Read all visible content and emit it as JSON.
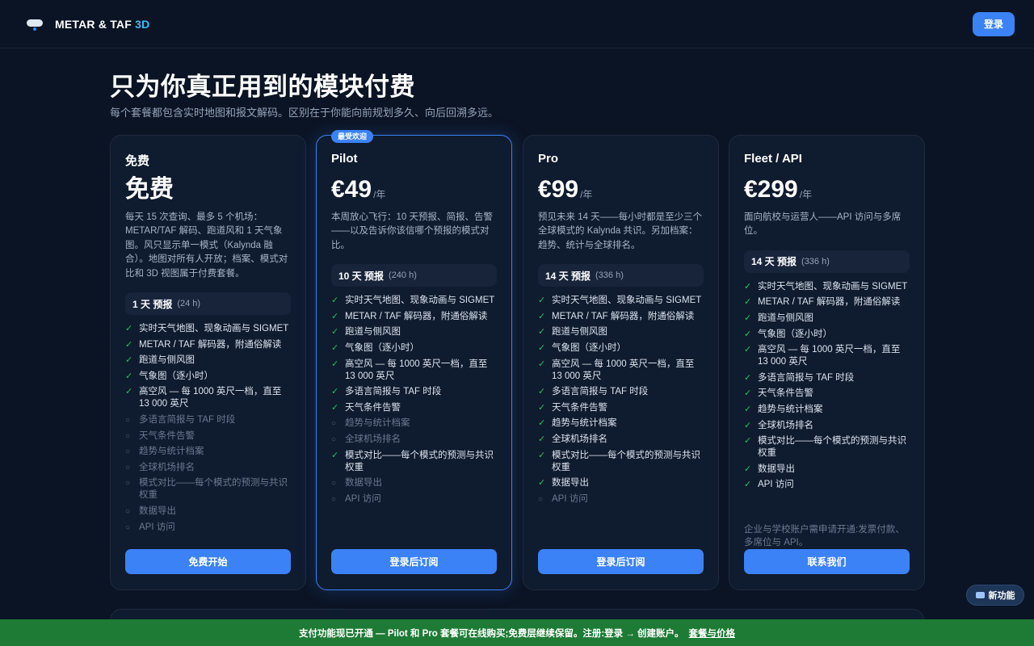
{
  "header": {
    "brand_main": "METAR & TAF",
    "brand_accent": "3D",
    "login_label": "登录"
  },
  "hero": {
    "title": "只为你真正用到的模块付费",
    "subtitle": "每个套餐都包含实时地图和报文解码。区别在于你能向前规划多久、向后回溯多远。"
  },
  "plans": [
    {
      "name": "免费",
      "price": "免费",
      "period": "",
      "badge": "",
      "description": "每天 15 次查询、最多 5 个机场：METAR/TAF 解码、跑道风和 1 天气象图。风只显示单一模式（Kalynda 融合）。地图对所有人开放；档案、模式对比和 3D 视图属于付费套餐。",
      "forecast_label": "1 天 预报",
      "forecast_hours": "(24 h)",
      "features": [
        {
          "label": "实时天气地图、现象动画与 SIGMET",
          "included": true
        },
        {
          "label": "METAR / TAF 解码器，附通俗解读",
          "included": true
        },
        {
          "label": "跑道与侧风图",
          "included": true
        },
        {
          "label": "气象图（逐小时）",
          "included": true
        },
        {
          "label": "高空风 — 每 1000 英尺一档，直至 13 000 英尺",
          "included": true
        },
        {
          "label": "多语言简报与 TAF 时段",
          "included": false
        },
        {
          "label": "天气条件告警",
          "included": false
        },
        {
          "label": "趋势与统计档案",
          "included": false
        },
        {
          "label": "全球机场排名",
          "included": false
        },
        {
          "label": "模式对比——每个模式的预测与共识权重",
          "included": false
        },
        {
          "label": "数据导出",
          "included": false
        },
        {
          "label": "API 访问",
          "included": false
        }
      ],
      "note": "",
      "cta_label": "免费开始"
    },
    {
      "name": "Pilot",
      "price": "€49",
      "period": "/年",
      "badge": "最受欢迎",
      "description": "本周放心飞行：10 天预报、简报、告警——以及告诉你该信哪个预报的模式对比。",
      "forecast_label": "10 天 预报",
      "forecast_hours": "(240 h)",
      "features": [
        {
          "label": "实时天气地图、现象动画与 SIGMET",
          "included": true
        },
        {
          "label": "METAR / TAF 解码器，附通俗解读",
          "included": true
        },
        {
          "label": "跑道与侧风图",
          "included": true
        },
        {
          "label": "气象图（逐小时）",
          "included": true
        },
        {
          "label": "高空风 — 每 1000 英尺一档，直至 13 000 英尺",
          "included": true
        },
        {
          "label": "多语言简报与 TAF 时段",
          "included": true
        },
        {
          "label": "天气条件告警",
          "included": true
        },
        {
          "label": "趋势与统计档案",
          "included": false
        },
        {
          "label": "全球机场排名",
          "included": false
        },
        {
          "label": "模式对比——每个模式的预测与共识权重",
          "included": true
        },
        {
          "label": "数据导出",
          "included": false
        },
        {
          "label": "API 访问",
          "included": false
        }
      ],
      "note": "",
      "cta_label": "登录后订阅"
    },
    {
      "name": "Pro",
      "price": "€99",
      "period": "/年",
      "badge": "",
      "description": "预见未来 14 天——每小时都是至少三个全球模式的 Kalynda 共识。另加档案：趋势、统计与全球排名。",
      "forecast_label": "14 天 预报",
      "forecast_hours": "(336 h)",
      "features": [
        {
          "label": "实时天气地图、现象动画与 SIGMET",
          "included": true
        },
        {
          "label": "METAR / TAF 解码器，附通俗解读",
          "included": true
        },
        {
          "label": "跑道与侧风图",
          "included": true
        },
        {
          "label": "气象图（逐小时）",
          "included": true
        },
        {
          "label": "高空风 — 每 1000 英尺一档，直至 13 000 英尺",
          "included": true
        },
        {
          "label": "多语言简报与 TAF 时段",
          "included": true
        },
        {
          "label": "天气条件告警",
          "included": true
        },
        {
          "label": "趋势与统计档案",
          "included": true
        },
        {
          "label": "全球机场排名",
          "included": true
        },
        {
          "label": "模式对比——每个模式的预测与共识权重",
          "included": true
        },
        {
          "label": "数据导出",
          "included": true
        },
        {
          "label": "API 访问",
          "included": false
        }
      ],
      "note": "",
      "cta_label": "登录后订阅"
    },
    {
      "name": "Fleet / API",
      "price": "€299",
      "period": "/年",
      "badge": "",
      "description": "面向航校与运营人——API 访问与多席位。",
      "forecast_label": "14 天 预报",
      "forecast_hours": "(336 h)",
      "features": [
        {
          "label": "实时天气地图、现象动画与 SIGMET",
          "included": true
        },
        {
          "label": "METAR / TAF 解码器，附通俗解读",
          "included": true
        },
        {
          "label": "跑道与侧风图",
          "included": true
        },
        {
          "label": "气象图（逐小时）",
          "included": true
        },
        {
          "label": "高空风 — 每 1000 英尺一档，直至 13 000 英尺",
          "included": true
        },
        {
          "label": "多语言简报与 TAF 时段",
          "included": true
        },
        {
          "label": "天气条件告警",
          "included": true
        },
        {
          "label": "趋势与统计档案",
          "included": true
        },
        {
          "label": "全球机场排名",
          "included": true
        },
        {
          "label": "模式对比——每个模式的预测与共识权重",
          "included": true
        },
        {
          "label": "数据导出",
          "included": true
        },
        {
          "label": "API 访问",
          "included": true
        }
      ],
      "note": "企业与学校账户需申请开通:发票付款、多席位与 API。",
      "cta_label": "联系我们"
    }
  ],
  "whats_new": {
    "label": "新功能",
    "icon": "new-badge-icon"
  },
  "banner": {
    "text": "支付功能现已开通 — Pilot 和 Pro 套餐可在线购买;免费层继续保留。注册:登录 → 创建账户。",
    "link_label": "套餐与价格"
  },
  "colors": {
    "background": "#0b1424",
    "card": "#0f1b2e",
    "accent": "#3b82f6",
    "brand_accent": "#38bdf8",
    "check": "#22c55e",
    "banner": "#1e7b35"
  }
}
